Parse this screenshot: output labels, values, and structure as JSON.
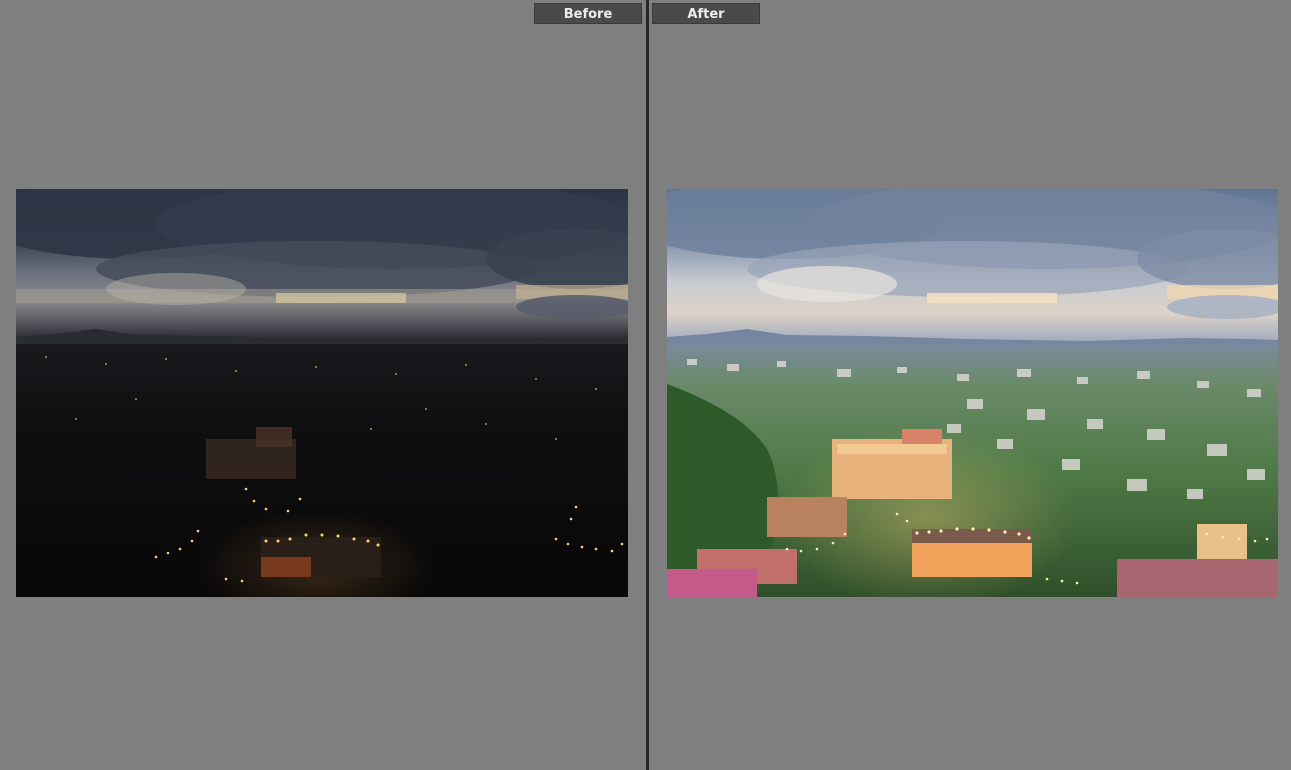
{
  "view": {
    "before_label": "Before",
    "after_label": "After"
  },
  "colors": {
    "background": "#7f7f7f",
    "label_bg": "#4a4a4a",
    "label_text": "#ededed",
    "divider": "#262626"
  },
  "images": {
    "before": {
      "description_icon": "photo-before-dark-cityscape"
    },
    "after": {
      "description_icon": "photo-after-bright-cityscape"
    }
  }
}
